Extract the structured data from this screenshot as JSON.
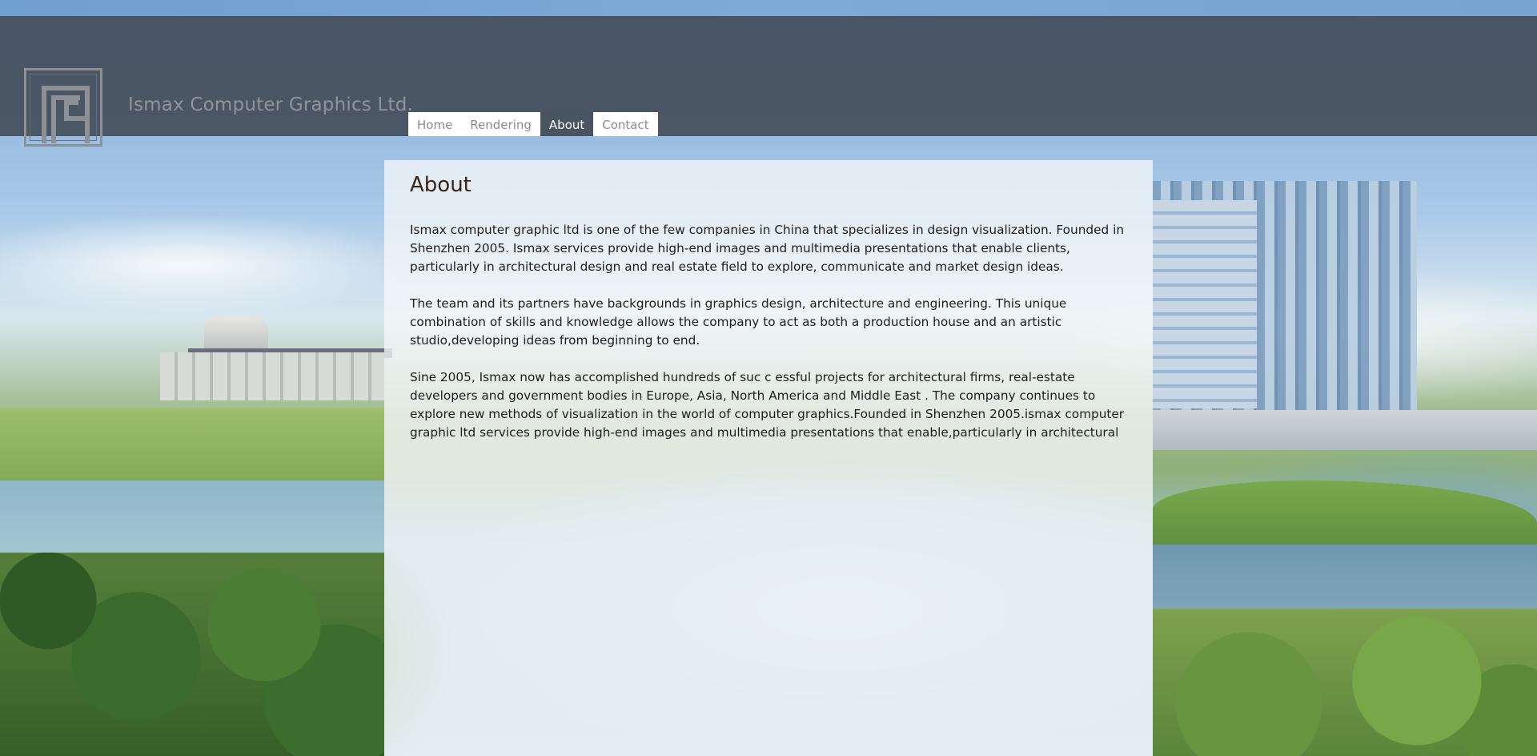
{
  "header": {
    "brand_name": "Ismax Computer Graphics Ltd.",
    "logo_icon": "ismax-logo-icon"
  },
  "nav": {
    "items": [
      {
        "label": "Home",
        "active": false
      },
      {
        "label": "Rendering",
        "active": false
      },
      {
        "label": "About",
        "active": true
      },
      {
        "label": "Contact",
        "active": false
      }
    ]
  },
  "content": {
    "title": "About",
    "paragraphs": [
      "Ismax computer graphic ltd is one of the few companies in China that specializes in design visualization. Founded in Shenzhen 2005. Ismax services provide high-end images and multimedia presentations that enable clients, particularly in architectural design and real estate field to explore, communicate and market design ideas.",
      "The team and its partners have backgrounds in graphics design, architecture and engineering. This unique combination of skills and knowledge allows the company to act as both a production house and an artistic studio,developing ideas from beginning to end.",
      "Sine 2005, Ismax now has accomplished hundreds of suc c essful projects for architectural firms, real-estate developers and government bodies in Europe, Asia, North America and Middle East . The company continues to explore new methods of visualization in the world of computer graphics.Founded in Shenzhen 2005.ismax computer graphic ltd services provide high-end images and multimedia presentations that enable,particularly in architectural"
    ]
  },
  "colors": {
    "header_bg": "#485260",
    "nav_active_bg": "#4a5360",
    "title_color": "#3a2414"
  }
}
